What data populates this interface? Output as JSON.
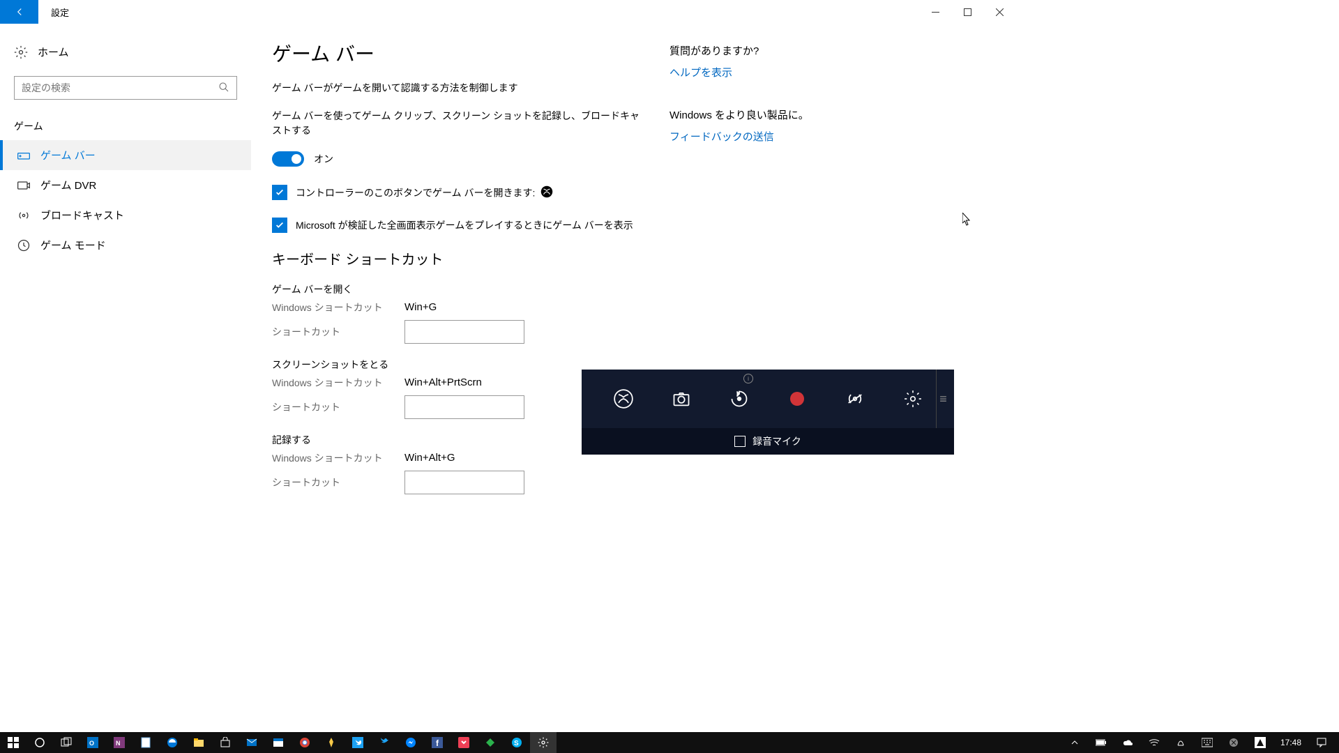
{
  "window": {
    "title": "設定"
  },
  "sidebar": {
    "home": "ホーム",
    "search_placeholder": "設定の検索",
    "group": "ゲーム",
    "items": [
      {
        "label": "ゲーム バー",
        "active": true
      },
      {
        "label": "ゲーム DVR"
      },
      {
        "label": "ブロードキャスト"
      },
      {
        "label": "ゲーム モード"
      }
    ]
  },
  "page": {
    "title": "ゲーム バー",
    "subtitle": "ゲーム バーがゲームを開いて認識する方法を制御します",
    "toggle_desc": "ゲーム バーを使ってゲーム クリップ、スクリーン ショットを記録し、ブロードキャストする",
    "toggle_state": "オン",
    "check1": "コントローラーのこのボタンでゲーム バーを開きます:",
    "check2": "Microsoft が検証した全画面表示ゲームをプレイするときにゲーム バーを表示",
    "kb_title": "キーボード ショートカット",
    "win_sc_label": "Windows ショートカット",
    "user_sc_label": "ショートカット",
    "groups": [
      {
        "name": "ゲーム バーを開く",
        "win": "Win+G"
      },
      {
        "name": "スクリーンショットをとる",
        "win": "Win+Alt+PrtScrn"
      },
      {
        "name": "記録する",
        "win": "Win+Alt+G"
      }
    ]
  },
  "right": {
    "q": "質問がありますか?",
    "help": "ヘルプを表示",
    "improve": "Windows をより良い製品に。",
    "feedback": "フィードバックの送信"
  },
  "gamebar": {
    "mic_label": "録音マイク"
  },
  "taskbar": {
    "clock": "17:48"
  }
}
